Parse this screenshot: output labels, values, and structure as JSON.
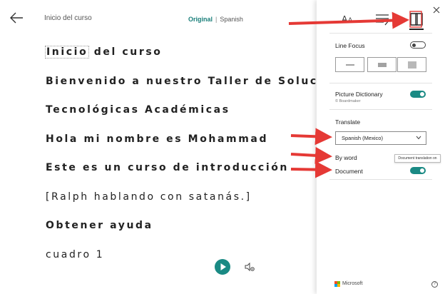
{
  "reader": {
    "title": "Inicio del curso",
    "lang_original": "Original",
    "lang_separator": "|",
    "lang_target": "Spanish",
    "lines": [
      {
        "first": "Inicio",
        "rest": " del curso",
        "style": "bold"
      },
      {
        "text": "Bienvenido a nuestro Taller de Solucione",
        "style": "bold"
      },
      {
        "text": "Tecnológicas Académicas",
        "style": "bold"
      },
      {
        "text": "Hola mi nombre es Mohammad",
        "style": "bold"
      },
      {
        "text": "Este es un curso de introducción",
        "style": "bold"
      },
      {
        "text": "[Ralph hablando con satanás.]",
        "style": "plain"
      },
      {
        "text": "Obtener ayuda",
        "style": "bold"
      },
      {
        "text": "cuadro 1",
        "style": "plain"
      }
    ]
  },
  "panel": {
    "tabs": [
      {
        "name": "text-preferences-icon"
      },
      {
        "name": "grammar-options-icon"
      },
      {
        "name": "reading-preferences-icon",
        "active": true
      }
    ],
    "line_focus": {
      "label": "Line Focus",
      "enabled": false
    },
    "picture_dictionary": {
      "label": "Picture Dictionary",
      "provider": "© Boardmaker",
      "enabled": true
    },
    "translate": {
      "label": "Translate",
      "selected_language": "Spanish (Mexico)",
      "by_word": {
        "label": "By word"
      },
      "document": {
        "label": "Document",
        "enabled": true
      },
      "tooltip": "Document translation on"
    },
    "footer": {
      "brand": "Microsoft",
      "help": "?"
    }
  },
  "colors": {
    "accent": "#1a8a84",
    "arrow": "#e53935"
  }
}
